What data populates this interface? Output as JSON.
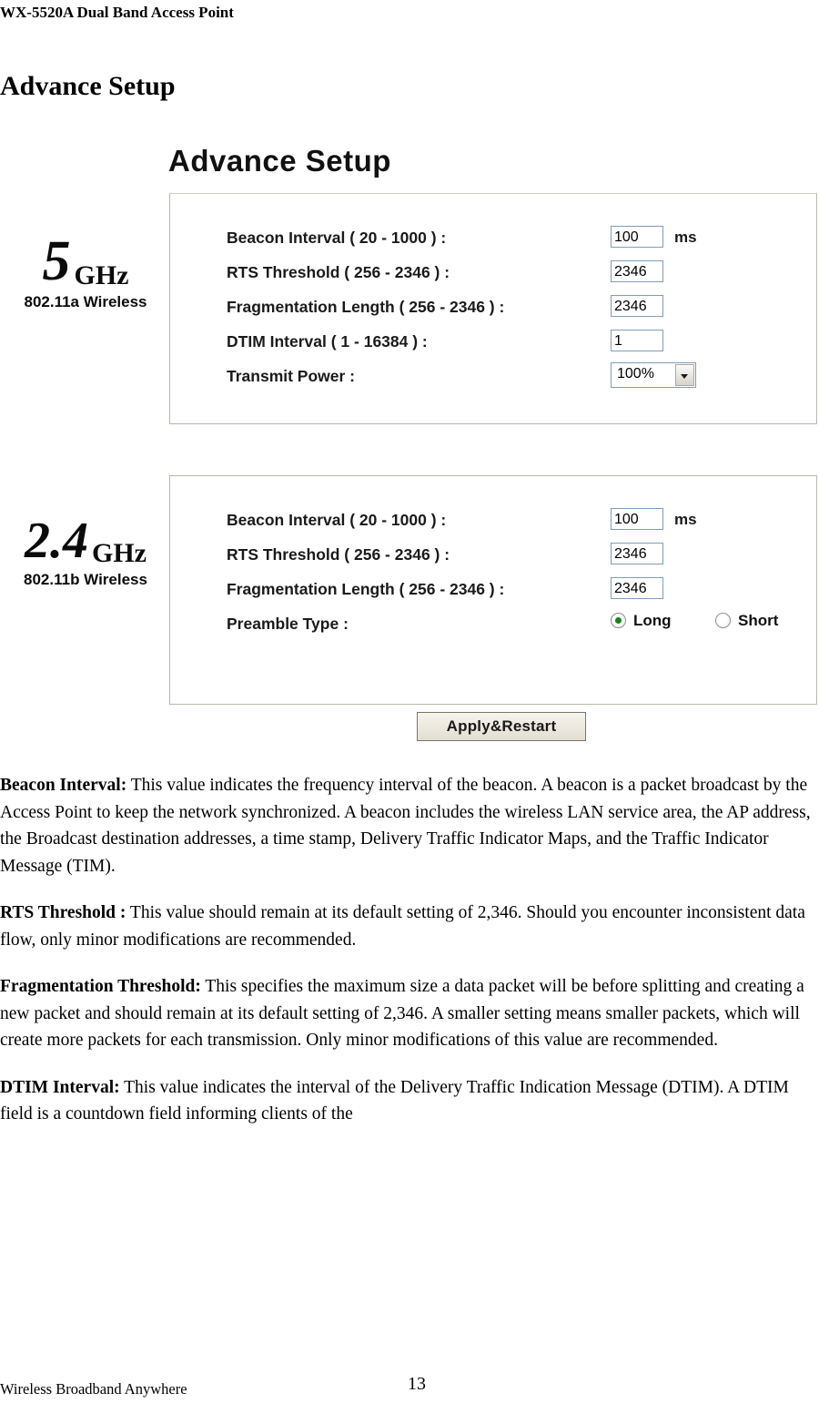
{
  "header": {
    "product_title": "WX-5520A Dual Band Access Point"
  },
  "page_heading": "Advance Setup",
  "figure": {
    "title": "Advance Setup",
    "logo_5ghz": {
      "big": "5",
      "unit": "GHz",
      "sub": "802.11a Wireless"
    },
    "logo_24ghz": {
      "big": "2.4",
      "unit": "GHz",
      "sub": "802.11b Wireless"
    },
    "panel_5ghz": {
      "rows": [
        {
          "label": "Beacon Interval ( 20 - 1000 ) :",
          "type": "text",
          "value": "100",
          "unit": "ms"
        },
        {
          "label": "RTS Threshold ( 256 - 2346 ) :",
          "type": "text",
          "value": "2346",
          "unit": ""
        },
        {
          "label": "Fragmentation Length ( 256 - 2346 ) :",
          "type": "text",
          "value": "2346",
          "unit": ""
        },
        {
          "label": "DTIM Interval ( 1 - 16384 ) :",
          "type": "text",
          "value": "1",
          "unit": ""
        },
        {
          "label": "Transmit Power :",
          "type": "select",
          "value": "100%",
          "unit": ""
        }
      ]
    },
    "panel_24ghz": {
      "rows": [
        {
          "label": "Beacon Interval ( 20 - 1000 ) :",
          "type": "text",
          "value": "100",
          "unit": "ms"
        },
        {
          "label": "RTS Threshold ( 256 - 2346 ) :",
          "type": "text",
          "value": "2346",
          "unit": ""
        },
        {
          "label": "Fragmentation Length ( 256 - 2346 ) :",
          "type": "text",
          "value": "2346",
          "unit": ""
        },
        {
          "label": "Preamble Type :",
          "type": "radio",
          "options": [
            "Long",
            "Short"
          ],
          "selected": "Long"
        }
      ]
    },
    "apply_button": "Apply&Restart"
  },
  "content": {
    "beacon_label": "Beacon Interval:",
    "beacon_text": " This value indicates the frequency interval of the beacon. A beacon is a packet broadcast by the Access Point to keep the network synchronized. A beacon includes the wireless LAN service area, the AP address, the Broadcast destination addresses, a time stamp, Delivery Traffic Indicator Maps, and the Traffic Indicator Message (TIM).",
    "rts_label": "RTS Threshold :",
    "rts_text": " This value should remain at its default setting of 2,346. Should you encounter inconsistent data flow, only minor modifications are recommended.",
    "frag_label": "Fragmentation Threshold:",
    "frag_text": " This specifies the maximum size a data packet will be before splitting and creating a new packet and should remain at its default setting of 2,346. A smaller setting means smaller packets, which will create more packets for each transmission. Only minor modifications of this value are recommended.",
    "dtim_label": "DTIM Interval:",
    "dtim_text": " This value indicates the interval of the Delivery Traffic Indication Message (DTIM). A DTIM field is a countdown field informing clients of the"
  },
  "footer": {
    "left": "Wireless Broadband Anywhere",
    "page_number": "13"
  }
}
